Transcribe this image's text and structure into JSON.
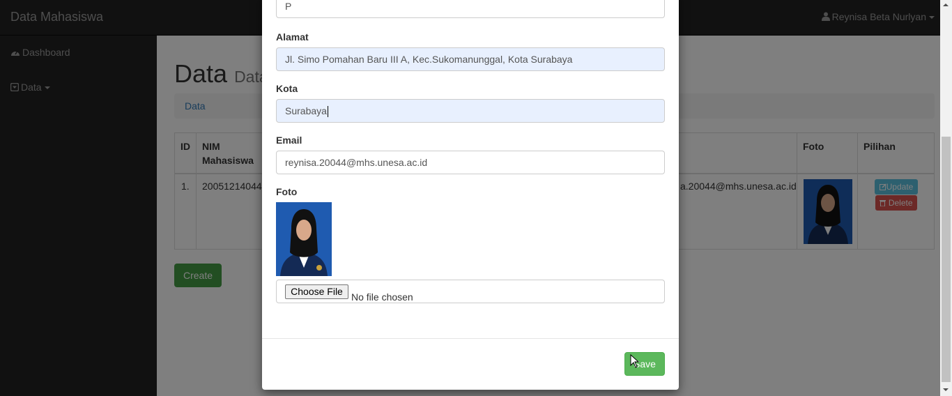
{
  "navbar": {
    "brand": "Data Mahasiswa",
    "user": "Reynisa Beta Nurlyan"
  },
  "sidebar": {
    "items": [
      {
        "label": "Dashboard",
        "icon": "dashboard-icon"
      },
      {
        "label": "Data",
        "icon": "caret-square-down-icon"
      }
    ]
  },
  "page": {
    "title": "Data",
    "subtitle": "Data",
    "breadcrumb": "Data",
    "table": {
      "headers": {
        "id": "ID",
        "nim_line1": "NIM",
        "nim_line2": "Mahasiswa",
        "foto": "Foto",
        "pilihan": "Pilihan"
      },
      "row": {
        "id": "1.",
        "nim": "20051214044",
        "email": "a.20044@mhs.unesa.ac.id"
      }
    },
    "update_label": "Update",
    "delete_label": "Delete",
    "create_label": "Create"
  },
  "modal": {
    "gender_value": "P",
    "alamat_label": "Alamat",
    "alamat_value": "Jl. Simo Pomahan Baru III A, Kec.Sukomanunggal, Kota Surabaya",
    "kota_label": "Kota",
    "kota_value": "Surabaya",
    "email_label": "Email",
    "email_value": "reynisa.20044@mhs.unesa.ac.id",
    "foto_label": "Foto",
    "file_button": "Choose File",
    "file_status": "No file chosen",
    "save_label": "Save"
  },
  "colors": {
    "primary": "#337ab7",
    "success": "#5cb85c",
    "info": "#5bc0de",
    "danger": "#d9534f",
    "autofill": "#e8f0fe"
  }
}
